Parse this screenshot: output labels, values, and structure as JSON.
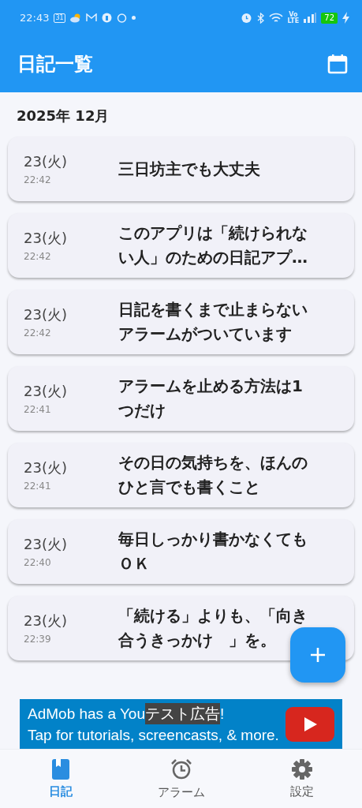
{
  "status_bar": {
    "time": "22:43",
    "calendar_day": "31",
    "network_label": "Vo\nLTE",
    "battery": "72"
  },
  "app_bar": {
    "title": "日記一覧"
  },
  "month_header": "2025年 12月",
  "entries": [
    {
      "day": "23(火)",
      "time": "22:42",
      "text": "三日坊主でも大丈夫"
    },
    {
      "day": "23(火)",
      "time": "22:42",
      "text": "このアプリは「続けられない人」のための日記アプ…"
    },
    {
      "day": "23(火)",
      "time": "22:42",
      "text": "日記を書くまで止まらないアラームがついています"
    },
    {
      "day": "23(火)",
      "time": "22:41",
      "text": "アラームを止める方法は1つだけ"
    },
    {
      "day": "23(火)",
      "time": "22:41",
      "text": "その日の気持ちを、ほんのひと言でも書くこと"
    },
    {
      "day": "23(火)",
      "time": "22:40",
      "text": "毎日しっかり書かなくてもＯＫ"
    },
    {
      "day": "23(火)",
      "time": "22:39",
      "text": "「続ける」よりも、「向き合うきっかけ　」を。"
    }
  ],
  "ad": {
    "line1_start": "AdMob has a You",
    "label": "テスト広告",
    "line1_end": "!",
    "line2": "Tap for tutorials, screencasts, & more."
  },
  "nav": [
    {
      "kind": "diary",
      "label": "日記",
      "selected": true
    },
    {
      "kind": "alarm",
      "label": "アラーム",
      "selected": false
    },
    {
      "kind": "settings",
      "label": "設定",
      "selected": false
    }
  ]
}
